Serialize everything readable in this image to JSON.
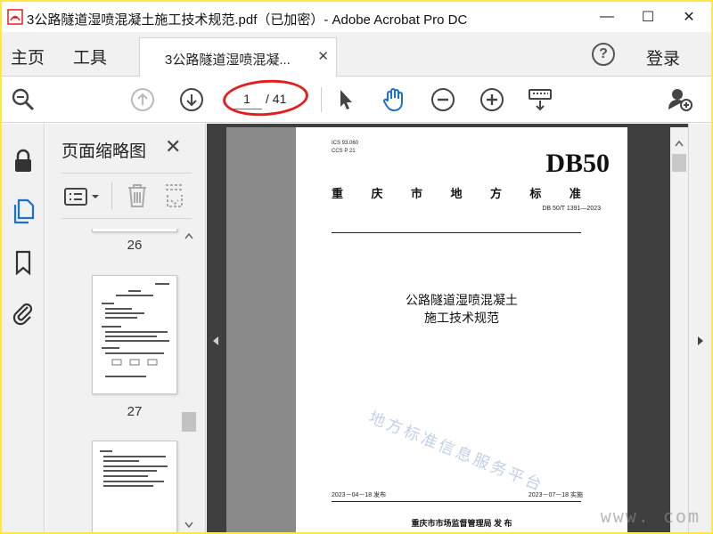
{
  "window": {
    "title": "3公路隧道湿喷混凝土施工技术规范.pdf（已加密）- Adobe Acrobat Pro DC",
    "minimize": "—",
    "maximize": "☐",
    "close": "✕"
  },
  "menu": {
    "home": "主页",
    "tools": "工具",
    "tab_label": "3公路隧道湿喷混凝...",
    "tab_close": "✕",
    "help": "?",
    "login": "登录"
  },
  "toolbar": {
    "current_page": "1",
    "total_pages": "/ 41"
  },
  "thumbnails": {
    "title": "页面缩略图",
    "close": "✕",
    "pages": [
      {
        "number": "26"
      },
      {
        "number": "27"
      }
    ]
  },
  "document": {
    "ics": "ICS  93.060",
    "ccs": "CCS  P 21",
    "db": "DB50",
    "standard_name_chars": [
      "重",
      "庆",
      "市",
      "地",
      "方",
      "标",
      "准"
    ],
    "code": "DB 50/T 1391—2023",
    "title_line1": "公路隧道湿喷混凝土",
    "title_line2": "施工技术规范",
    "publish_date": "2023－04－18 发布",
    "effective_date": "2023－07－18 实施",
    "publisher": "重庆市市场监督管理局    发 布",
    "watermark": "地方标准信息服务平台",
    "corner_watermark": "www.     com"
  },
  "colors": {
    "outer_border": "#ffe74a",
    "annotation": "#e02020",
    "accent": "#1a73c8"
  }
}
